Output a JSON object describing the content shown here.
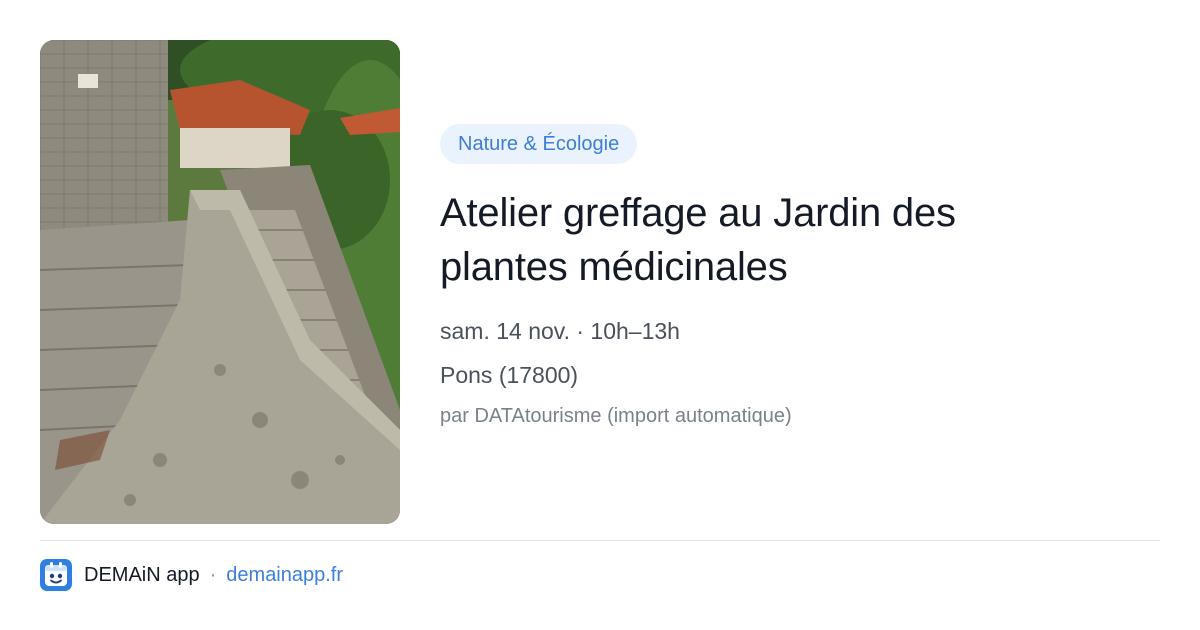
{
  "event": {
    "category": "Nature & Écologie",
    "title_line1": "Atelier greffage au Jardin des",
    "title_line2": "plantes médicinales",
    "datetime": "sam. 14 nov. · 10h–13h",
    "location": "Pons (17800)",
    "source": "par DATAtourisme (import automatique)"
  },
  "footer": {
    "app_name": "DEMAiN app",
    "separator": "·",
    "link": "demainapp.fr"
  },
  "colors": {
    "accent": "#3b7fd9",
    "tag_bg": "#eaf2fd",
    "title": "#141a26",
    "meta": "#4a515c",
    "muted": "#7a818c"
  },
  "icons": {
    "app_logo": "demain-app-icon"
  }
}
